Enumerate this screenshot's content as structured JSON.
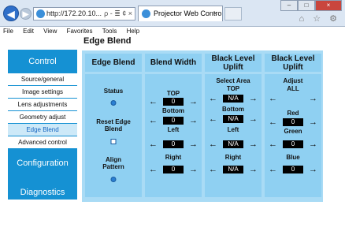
{
  "browser": {
    "address": "http://172.20.10...",
    "address_controls": "ρ - ≣ ¢ ×",
    "tab_title": "Projector Web Control",
    "tab_close": "×",
    "win_min": "–",
    "win_max": "□",
    "win_close": "×",
    "right_icons": "⌂ ☆ ⚙"
  },
  "menu": {
    "file": "File",
    "edit": "Edit",
    "view": "View",
    "favorites": "Favorites",
    "tools": "Tools",
    "help": "Help"
  },
  "page": {
    "title": "Edge Blend"
  },
  "sidebar": {
    "control": "Control",
    "items": [
      {
        "label": "Source/general"
      },
      {
        "label": "Image settings"
      },
      {
        "label": "Lens adjustments"
      },
      {
        "label": "Geometry adjust"
      },
      {
        "label": "Edge Blend"
      },
      {
        "label": "Advanced control"
      }
    ],
    "configuration": "Configuration",
    "diagnostics": "Diagnostics"
  },
  "edge_blend": {
    "header": "Edge Blend",
    "status_label": "Status",
    "reset_label": "Reset Edge Blend",
    "align_label": "Align Pattern"
  },
  "blend_width": {
    "header": "Blend Width",
    "top_label": "TOP",
    "top_value": "0",
    "bottom_label": "Bottom",
    "bottom_value": "0",
    "left_label": "Left",
    "left_value": "0",
    "right_label": "Right",
    "right_value": "0"
  },
  "black_select": {
    "header": "Black Level Uplift",
    "sub": "Select Area",
    "top_label": "TOP",
    "top_value": "N/A",
    "bottom_label": "Bottom",
    "bottom_value": "N/A",
    "left_label": "Left",
    "left_value": "N/A",
    "right_label": "Right",
    "right_value": "N/A"
  },
  "black_adjust": {
    "header": "Black Level Uplift",
    "sub": "Adjust",
    "all_label": "ALL",
    "red_label": "Red",
    "red_value": "0",
    "green_label": "Green",
    "green_value": "0",
    "blue_label": "Blue",
    "blue_value": "0"
  },
  "glyphs": {
    "left_arrow": "←",
    "right_arrow": "→",
    "back": "◀",
    "forward": "▶"
  }
}
